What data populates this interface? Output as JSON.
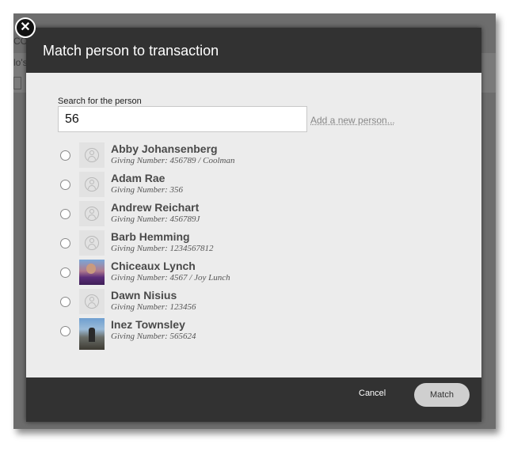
{
  "background": {
    "fragments": [
      "CO",
      "lo's"
    ]
  },
  "modal": {
    "title": "Match person to transaction",
    "close_icon": "close-circle-icon"
  },
  "search": {
    "label": "Search for the person",
    "value": "56",
    "add_link": "Add a new person..."
  },
  "people": [
    {
      "name": "Abby Johansenberg",
      "giving": "Giving Number: 456789 / Coolman",
      "avatar": "placeholder"
    },
    {
      "name": "Adam Rae",
      "giving": "Giving Number: 356",
      "avatar": "placeholder"
    },
    {
      "name": "Andrew Reichart",
      "giving": "Giving Number: 456789J",
      "avatar": "placeholder"
    },
    {
      "name": "Barb Hemming",
      "giving": "Giving Number: 1234567812",
      "avatar": "placeholder"
    },
    {
      "name": "Chiceaux Lynch",
      "giving": "Giving Number: 4567 / Joy Lunch",
      "avatar": "photo"
    },
    {
      "name": "Dawn Nisius",
      "giving": "Giving Number: 123456",
      "avatar": "placeholder"
    },
    {
      "name": "Inez Townsley",
      "giving": "Giving Number: 565624",
      "avatar": "photo"
    }
  ],
  "footer": {
    "cancel_label": "Cancel",
    "match_label": "Match"
  },
  "colors": {
    "header": "#323232",
    "body": "#ececec",
    "match_button": "#cfcfcf"
  }
}
